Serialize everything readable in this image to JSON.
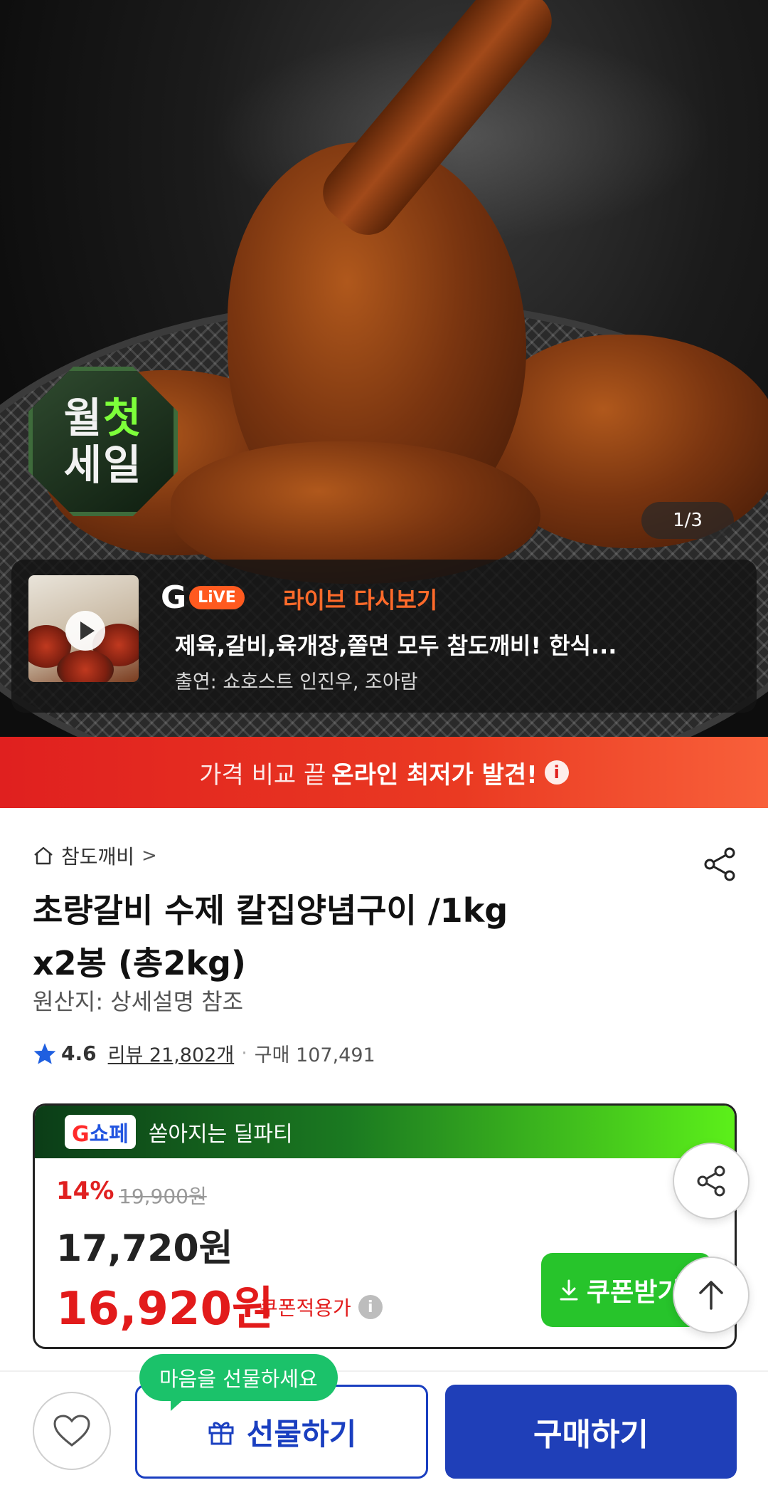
{
  "hero": {
    "badge_line1_a": "월",
    "badge_line1_b": "첫",
    "badge_line2": "세일",
    "image_counter": "1/3"
  },
  "live": {
    "logo_g": "G",
    "logo_live": "LiVE",
    "title": "라이브 다시보기",
    "description": "제육,갈비,육개장,쫄면 모두 참도깨비! 한식...",
    "cast": "출연: 쇼호스트 인진우, 조아람"
  },
  "compare": {
    "text_normal": "가격 비교 끝",
    "text_bold": "온라인 최저가 발견!",
    "info_icon": "i"
  },
  "product": {
    "breadcrumb": "참도깨비",
    "breadcrumb_chevron": ">",
    "title_line1": "초량갈비 수제 칼집양념구이 /1kg",
    "title_line2": "x2봉 (총2kg)",
    "origin": "원산지: 상세설명 참조",
    "rating": "4.6",
    "review": "리뷰 21,802개",
    "separator": "·",
    "purchases": "구매 107,491"
  },
  "deal": {
    "logo_g": "G",
    "logo_rest": "쇼페",
    "header_text": "쏟아지는 딜파티",
    "discount": "14%",
    "original_price": "19,900원",
    "sale_price": "17,720원",
    "coupon_price": "16,920원",
    "coupon_label": "쿠폰적용가",
    "coupon_info_icon": "i",
    "coupon_button": "쿠폰받기"
  },
  "bottom": {
    "gift_tooltip": "마음을 선물하세요",
    "gift_button": "선물하기",
    "buy_button": "구매하기"
  },
  "colors": {
    "accent_red": "#e21b1b",
    "buy_blue": "#1f3fb8",
    "coupon_green": "#27c42b",
    "tooltip_green": "#1bc26a",
    "live_orange": "#ff6a2a"
  },
  "icons": {
    "home": "home-icon",
    "share": "share-icon",
    "star": "star-icon",
    "info": "info-icon",
    "download": "download-icon",
    "arrow_up": "arrow-up-icon",
    "heart": "heart-icon",
    "gift": "gift-icon",
    "play": "play-icon"
  }
}
